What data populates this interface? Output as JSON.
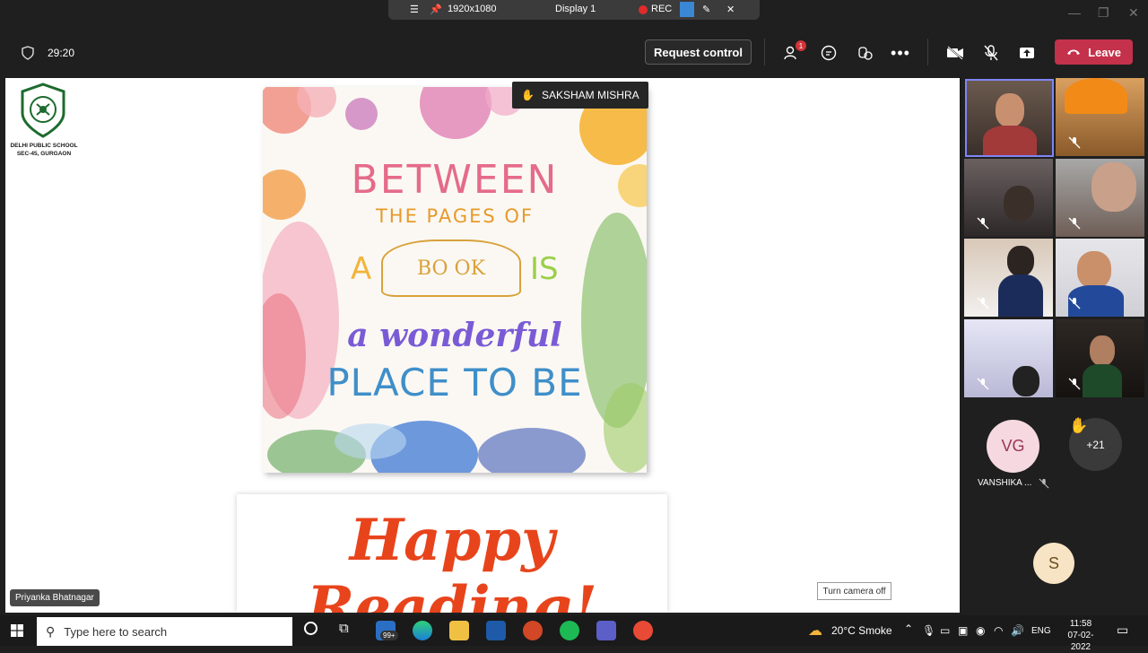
{
  "share_bar": {
    "resolution": "1920x1080",
    "display": "Display 1",
    "rec_label": "REC"
  },
  "meeting": {
    "timer": "29:20",
    "request_control_label": "Request control",
    "leave_label": "Leave",
    "participants_badge": "1"
  },
  "stage": {
    "school_name_line1": "DELHI PUBLIC SCHOOL",
    "school_name_line2": "SEC-45, GURGAON",
    "hand_raised_name": "SAKSHAM MISHRA",
    "poster": {
      "line1": "BETWEEN",
      "line2": "THE PAGES OF",
      "a": "A",
      "book": "BO OK",
      "is": "IS",
      "line4": "a wonderful",
      "line5": "PLACE TO BE"
    },
    "happy_reading": "Happy Reading!",
    "presenter_name": "Priyanka Bhatnagar",
    "turn_camera_off": "Turn camera off"
  },
  "participants": {
    "vg_initials": "VG",
    "vg_name": "VANSHIKA ...",
    "more_count": "+21",
    "s_initial": "S"
  },
  "taskbar": {
    "search_placeholder": "Type here to search",
    "mail_badge": "99+",
    "weather": "20°C  Smoke",
    "lang": "ENG",
    "time": "11:58",
    "date": "07-02-2022"
  },
  "colors": {
    "leave": "#c4314b",
    "rec": "#e02b2b",
    "accent": "#6264a7"
  }
}
